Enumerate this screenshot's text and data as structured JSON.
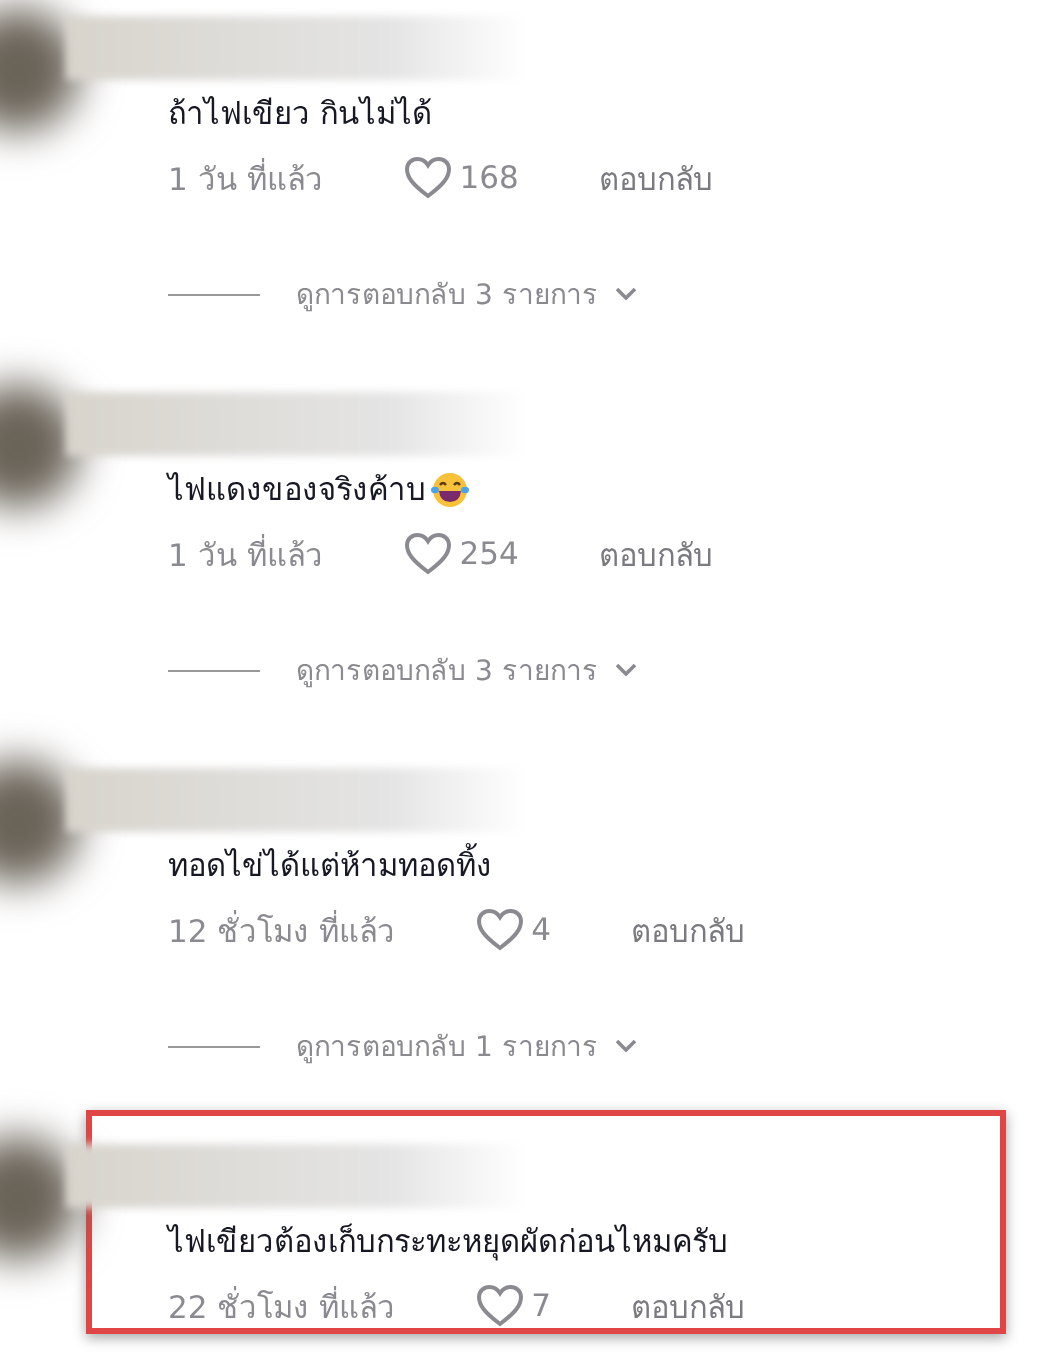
{
  "comments": [
    {
      "text": "ถ้าไฟเขียว กินไม่ได้",
      "has_emoji": false,
      "time": "1 วัน ที่แล้ว",
      "likes": "168",
      "reply_label": "ตอบกลับ",
      "replies_link": "ดูการตอบกลับ 3 รายการ",
      "highlighted": false
    },
    {
      "text": "ไฟแดงของจริงค้าบ",
      "has_emoji": true,
      "time": "1 วัน ที่แล้ว",
      "likes": "254",
      "reply_label": "ตอบกลับ",
      "replies_link": "ดูการตอบกลับ 3 รายการ",
      "highlighted": false
    },
    {
      "text": "ทอดไข่ได้แต่ห้ามทอดทิ้ง",
      "has_emoji": false,
      "time": "12 ชั่วโมง ที่แล้ว",
      "likes": "4",
      "reply_label": "ตอบกลับ",
      "replies_link": "ดูการตอบกลับ 1 รายการ",
      "highlighted": false
    },
    {
      "text": "ไฟเขียวต้องเก็บกระทะหยุดผัดก่อนไหมครับ",
      "has_emoji": false,
      "time": "22 ชั่วโมง ที่แล้ว",
      "likes": "7",
      "reply_label": "ตอบกลับ",
      "highlighted": true
    }
  ]
}
